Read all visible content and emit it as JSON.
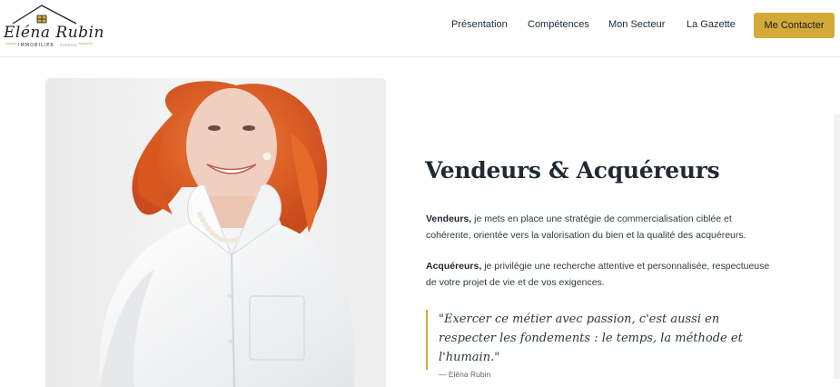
{
  "header": {
    "logo": {
      "script": "Eléna Rubin",
      "subtitle": "IMMOBILIER",
      "subtitle_small": "EXPERTISE"
    },
    "nav": [
      {
        "label": "Présentation"
      },
      {
        "label": "Compétences"
      },
      {
        "label": "Mon Secteur"
      },
      {
        "label": "La Gazette"
      }
    ],
    "cta_label": "Me Contacter"
  },
  "main": {
    "heading": "Vendeurs & Acquéreurs",
    "vendeurs": {
      "bold": "Vendeurs,",
      "text": " je mets en place une stratégie de commercialisation ciblée et cohérente, orientée vers la valorisation du bien et la qualité des acquéreurs."
    },
    "acquereurs": {
      "bold": "Acquéreurs,",
      "text": " je privilégie une recherche attentive et personnalisée, respectueuse de votre projet de vie et de vos exigences."
    },
    "quote": {
      "text": "\"Exercer ce métier avec passion, c'est aussi en respecter les fondements : le temps, la méthode et l'humain.\"",
      "author": "— Eléna Rubin"
    }
  },
  "colors": {
    "accent": "#d3a938",
    "heading": "#1f2a35",
    "hair": "#e2622a"
  }
}
